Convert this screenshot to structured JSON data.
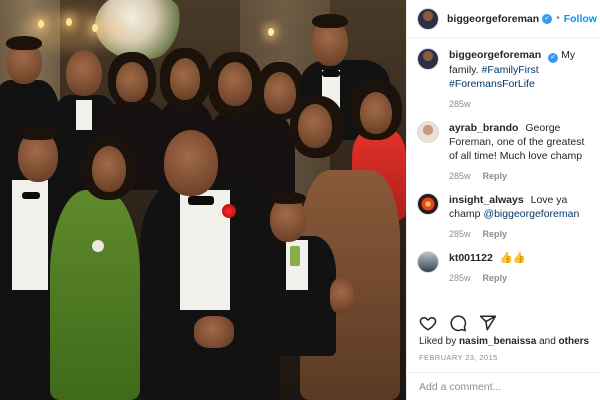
{
  "post": {
    "author": "biggeorgeforeman",
    "follow_label": "Follow",
    "dot": "•"
  },
  "caption": {
    "username": "biggeorgeforeman",
    "text": "My family.",
    "hashtags": "#FamilyFirst #ForemansForLife",
    "age": "285w"
  },
  "comments": [
    {
      "username": "ayrab_brando",
      "text": "George Foreman, one of the greatest of all time! Much love champ",
      "age": "285w",
      "reply_label": "Reply",
      "avatar_icon": "user-avatar-icon"
    },
    {
      "username": "insight_always",
      "text": "Love ya champ",
      "mention": "@biggeorgeforeman",
      "age": "285w",
      "reply_label": "Reply",
      "avatar_icon": "user-avatar-icon"
    },
    {
      "username": "kt001122",
      "text": "👍👍",
      "age": "285w",
      "reply_label": "Reply",
      "avatar_icon": "user-avatar-icon"
    }
  ],
  "likes": {
    "prefix": "Liked by",
    "user": "nasim_benaissa",
    "connector": "and",
    "others": "others"
  },
  "date": "FEBRUARY 23, 2015",
  "add_comment": {
    "placeholder": "Add a comment..."
  },
  "colors": {
    "link": "#0095f6",
    "hashtag": "#00376b",
    "muted": "#8e8e8e",
    "verified": "#3897f0"
  }
}
